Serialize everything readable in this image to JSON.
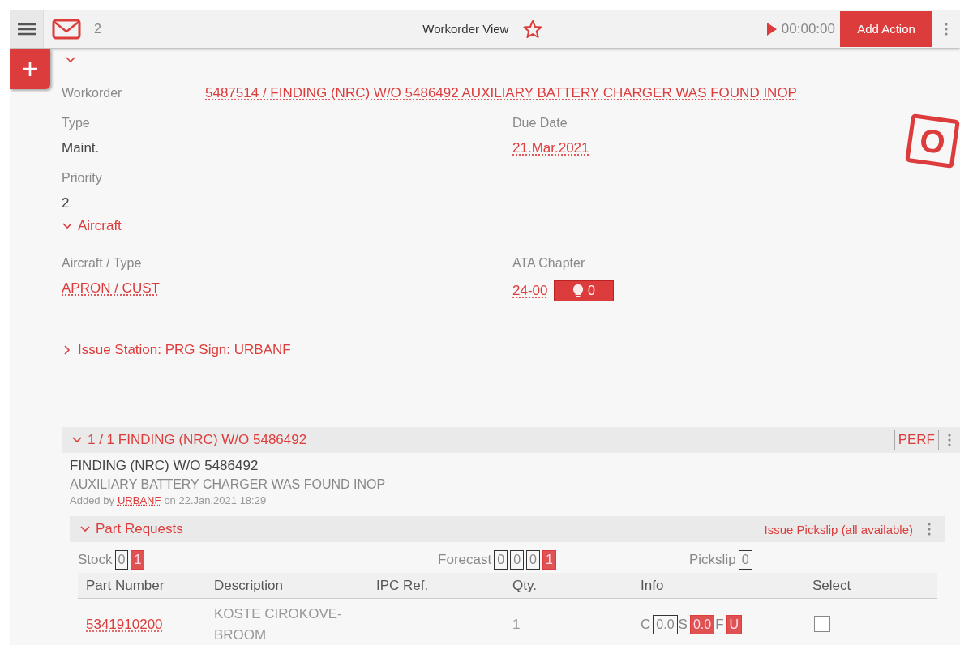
{
  "topbar": {
    "message_count": "2",
    "title": "Workorder View",
    "favorite": false,
    "timer": "00:00:00",
    "add_action": "Add Action"
  },
  "header_expanded": true,
  "workorder": {
    "label": "Workorder",
    "value": "5487514 / FINDING (NRC) W/O 5486492 AUXILIARY BATTERY CHARGER WAS FOUND INOP"
  },
  "stamp": "O",
  "fields": [
    {
      "label": "Type",
      "value": "Maint.",
      "link": false
    },
    {
      "label": "Due Date",
      "value": "21.Mar.2021",
      "link": true
    },
    {
      "label": "Priority",
      "value": "2",
      "link": false
    }
  ],
  "aircraft": {
    "title": "Aircraft",
    "expanded": true,
    "fields": [
      {
        "label": "Aircraft / Type",
        "value": "APRON / CUST"
      },
      {
        "label": "ATA Chapter",
        "value": "24-00",
        "hint_count": "0"
      }
    ]
  },
  "issue_station": {
    "title": "Issue Station: PRG Sign: URBANF",
    "expanded": false
  },
  "finding": {
    "title": "1 / 1 FINDING (NRC) W/O 5486492",
    "expanded": true,
    "action": "PERF",
    "name": "FINDING (NRC) W/O 5486492",
    "description": "AUXILIARY BATTERY CHARGER WAS FOUND INOP",
    "added_prefix": "Added by",
    "added_user": "URBANF",
    "added_suffix": "on 22.Jan.2021 18:29"
  },
  "part_requests": {
    "title": "Part Requests",
    "expanded": true,
    "action": "Issue Pickslip (all available)",
    "counters": [
      {
        "label": "Stock",
        "values": [
          {
            "value": "0",
            "highlighted": false
          },
          {
            "value": "1",
            "highlighted": true
          }
        ]
      },
      {
        "label": "Forecast",
        "values": [
          {
            "value": "0",
            "highlighted": false
          },
          {
            "value": "0",
            "highlighted": false
          },
          {
            "value": "0",
            "highlighted": false
          },
          {
            "value": "1",
            "highlighted": true
          }
        ]
      },
      {
        "label": "Pickslip",
        "values": [
          {
            "value": "0",
            "highlighted": false
          }
        ]
      }
    ],
    "columns": [
      "Part Number",
      "Description",
      "IPC Ref.",
      "Qty.",
      "Info",
      "Select"
    ],
    "rows": [
      {
        "part_number": "5341910200",
        "description": "KOSTE CIROKOVE-BROOM",
        "qty": "1",
        "info": [
          {
            "label": "C",
            "value": "0.0",
            "highlighted": false
          },
          {
            "label": "S",
            "value": "0.0",
            "highlighted": true
          },
          {
            "label": "F",
            "value": "U",
            "highlighted": true
          }
        ],
        "checked": false
      }
    ]
  }
}
